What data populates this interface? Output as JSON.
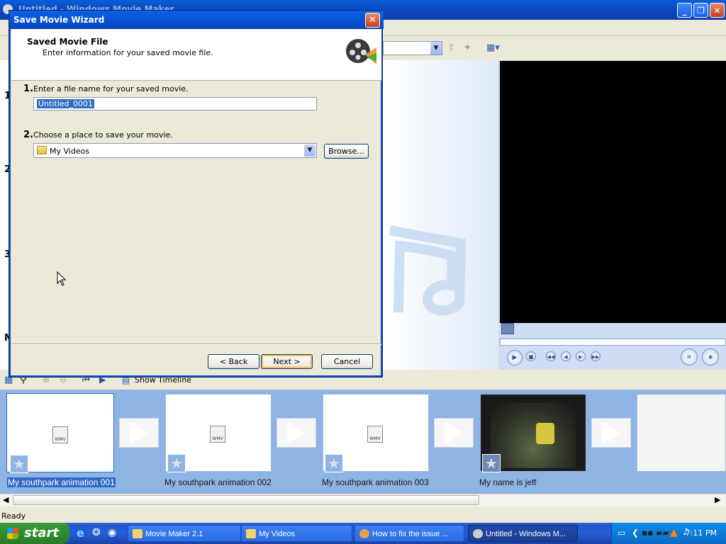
{
  "main_window": {
    "title": "Untitled - Windows Movie Maker"
  },
  "task_numbers": [
    "1",
    "2",
    "3",
    "M"
  ],
  "dialog": {
    "title": "Save Movie Wizard",
    "header_title": "Saved Movie File",
    "header_subtitle": "Enter information for your saved movie file.",
    "step1_number": "1.",
    "step1_label": "Enter a file name for your saved movie.",
    "filename_value": "Untitled_0001",
    "step2_number": "2.",
    "step2_label": "Choose a place to save your movie.",
    "location_value": "My Videos",
    "browse_label": "Browse...",
    "back_label": "< Back",
    "next_label": "Next >",
    "cancel_label": "Cancel"
  },
  "storyboard": {
    "toolbar_label": "Show Timeline",
    "clips": [
      {
        "label": "My southpark animation 001",
        "selected": true
      },
      {
        "label": "My southpark animation 002",
        "selected": false
      },
      {
        "label": "My southpark animation 003",
        "selected": false
      },
      {
        "label": "My name is jeff",
        "selected": false
      }
    ],
    "wmv_text": "WMV"
  },
  "status_bar": {
    "text": "Ready"
  },
  "taskbar": {
    "start_label": "start",
    "tasks": [
      {
        "label": "Movie Maker 2.1",
        "icon": "folder-icon",
        "active": false
      },
      {
        "label": "My Videos",
        "icon": "folder-icon",
        "active": false
      },
      {
        "label": "How to fix the issue ...",
        "icon": "browser-icon",
        "active": false
      },
      {
        "label": "Untitled - Windows M...",
        "icon": "movie-maker-icon",
        "active": true
      }
    ],
    "clock": "7:11 PM"
  },
  "colors": {
    "selection": "#316ac5",
    "title_bar": "#0a5fd8",
    "storyboard_bg": "#8eb4e3",
    "start_green": "#2f8f2f"
  }
}
